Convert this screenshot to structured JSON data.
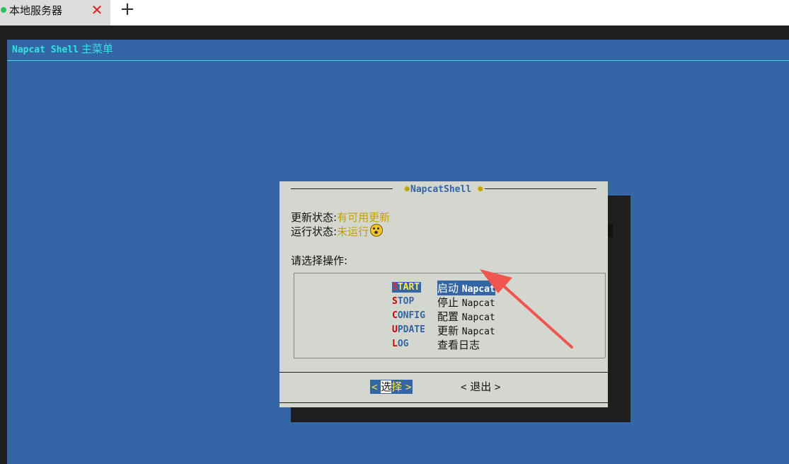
{
  "tab": {
    "title": "本地服务器",
    "close_glyph": "✕",
    "new_tab_glyph": "+",
    "status_color": "#22c55e"
  },
  "terminal": {
    "header_app": "Napcat Shell",
    "header_title": "主菜单",
    "dialog": {
      "title": "NapcatShell",
      "update_label": "更新状态:",
      "update_value": "有可用更新",
      "run_label": "运行状态:",
      "run_value": "未运行",
      "run_icon": "sleeping-face-icon",
      "prompt": "请选择操作:",
      "menu": [
        {
          "tag": "START",
          "desc_zh": "启动",
          "desc_en": "Napcat",
          "selected": true
        },
        {
          "tag": "STOP",
          "desc_zh": "停止",
          "desc_en": "Napcat",
          "selected": false
        },
        {
          "tag": "CONFIG",
          "desc_zh": "配置",
          "desc_en": "Napcat",
          "selected": false
        },
        {
          "tag": "UPDATE",
          "desc_zh": "更新",
          "desc_en": "Napcat",
          "selected": false
        },
        {
          "tag": "LOG",
          "desc_zh": "查看日志",
          "desc_en": "",
          "selected": false
        }
      ],
      "buttons": {
        "select": "选择",
        "exit": "退出"
      }
    }
  },
  "colors": {
    "screen_bg": "#3465a4",
    "dialog_bg": "#d3d7cf",
    "accent_cyan": "#34e2e2",
    "status_yellow": "#c4a000",
    "hotkey_red": "#cc0000",
    "arrow_red": "#f0554f"
  }
}
